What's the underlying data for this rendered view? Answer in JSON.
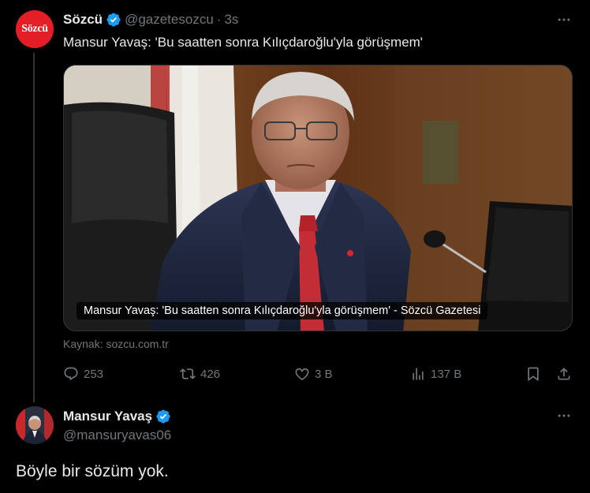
{
  "tweet": {
    "author_name": "Sözcü",
    "handle": "@gazetesozcu",
    "separator": "·",
    "time": "3s",
    "avatar_text": "Sözcü",
    "text": "Mansur Yavaş: 'Bu saatten sonra Kılıçdaroğlu'yla görüşmem'",
    "media_caption": "Mansur Yavaş: 'Bu saatten sonra Kılıçdaroğlu'yla görüşmem' - Sözcü Gazetesi",
    "source": "Kaynak: sozcu.com.tr",
    "stats": {
      "replies": "253",
      "reposts": "426",
      "likes": "3 B",
      "views": "137 B"
    }
  },
  "reply": {
    "author_name": "Mansur Yavaş",
    "handle": "@mansuryavas06",
    "text": "Böyle bir sözüm yok."
  },
  "colors": {
    "background": "#000000",
    "text": "#e7e9ea",
    "muted": "#71767b",
    "verified": "#1d9bf0",
    "brand_red": "#e41e26"
  },
  "icons": {
    "verified": "verified-badge-icon",
    "more": "more-dots-icon",
    "reply": "reply-icon",
    "repost": "repost-icon",
    "like": "heart-icon",
    "views": "views-chart-icon",
    "bookmark": "bookmark-icon",
    "share": "share-icon"
  }
}
